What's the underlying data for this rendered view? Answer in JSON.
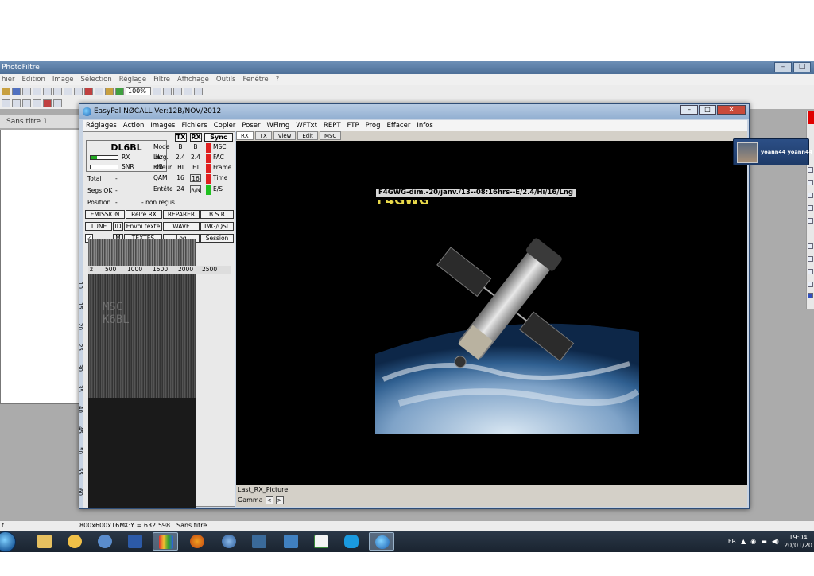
{
  "photofiltre": {
    "title": "PhotoFiltre",
    "menu": [
      "hier",
      "Edition",
      "Image",
      "Sélection",
      "Réglage",
      "Filtre",
      "Affichage",
      "Outils",
      "Fenêtre",
      "?"
    ],
    "zoom": "100%",
    "doc_tab": "Sans titre 1",
    "status": {
      "left": "t",
      "size": "800x600x16M",
      "coords": "X:Y = 632:598",
      "doc": "Sans titre 1"
    }
  },
  "easypal": {
    "title": "EasyPal  NØCALL  Ver:12B/NOV/2012",
    "menu": [
      "Réglages",
      "Action",
      "Images",
      "Fichiers",
      "Copier",
      "Poser",
      "WFimg",
      "WFTxt",
      "REPT",
      "FTP",
      "Prog",
      "Effacer",
      "Infos"
    ],
    "callsign": "DL6BL",
    "rx_label": "RX",
    "snr_label": "SNR",
    "hz_label": "Hz",
    "db_label": "dB",
    "total_label": "Total",
    "total_value": "-",
    "segs_label": "Segs OK",
    "segs_value": "-",
    "position_label": "Position",
    "position_value": "-",
    "non_recus": "- non reçus",
    "rows": {
      "labels": [
        "Mode",
        "Larg.",
        "Erreur",
        "QAM",
        "Entête"
      ],
      "tx_header": "TX",
      "rx_header": "RX",
      "tx_values": [
        "B",
        "2.4",
        "HI",
        "16",
        "24"
      ],
      "rx_values": [
        "B",
        "2.4",
        "HI",
        "16",
        "R/N"
      ]
    },
    "sync": {
      "header": "Sync",
      "items": [
        "MSC",
        "FAC",
        "Frame",
        "Time",
        "E/S"
      ]
    },
    "buttons_row1": [
      "EMISSION",
      "Relre RX",
      "REPARER",
      "B S R"
    ],
    "buttons_row2": [
      "TUNE",
      "ID",
      "Envoi texte",
      "WAVE",
      "IMG/QSL"
    ],
    "buttons_row3": [
      "M",
      "TEXTES",
      "Log",
      "Session"
    ],
    "freq_scale": [
      "z",
      "500",
      "1000",
      "1500",
      "2000",
      "2500"
    ],
    "time_scale": [
      "10",
      "15",
      "20",
      "25",
      "30",
      "35",
      "40",
      "45",
      "50",
      "55",
      "60"
    ],
    "waterfall_text": "MSC\nK6BL",
    "tabs": [
      "RX",
      "TX",
      "View",
      "Edit",
      "MSC"
    ],
    "picture_caption": "F4GWG-dim.-20/janv./13--08:16hrs--E/2.4/Hi/16/Lng",
    "picture_overlay": "F4GWG",
    "last_picture": "Last_RX_Picture",
    "gamma_label": "Gamma",
    "gamma_prev": "<",
    "gamma_next": ">"
  },
  "notification": {
    "text": "yoann44 yoann44"
  },
  "taskbar": {
    "lang": "FR",
    "time": "19:04",
    "date": "20/01/20",
    "apps": [
      "explorer",
      "photo-viewer",
      "settings",
      "word",
      "photofiltre",
      "firefox",
      "thunderbird",
      "monitor",
      "sstv",
      "garden",
      "skype",
      "easypal"
    ]
  }
}
